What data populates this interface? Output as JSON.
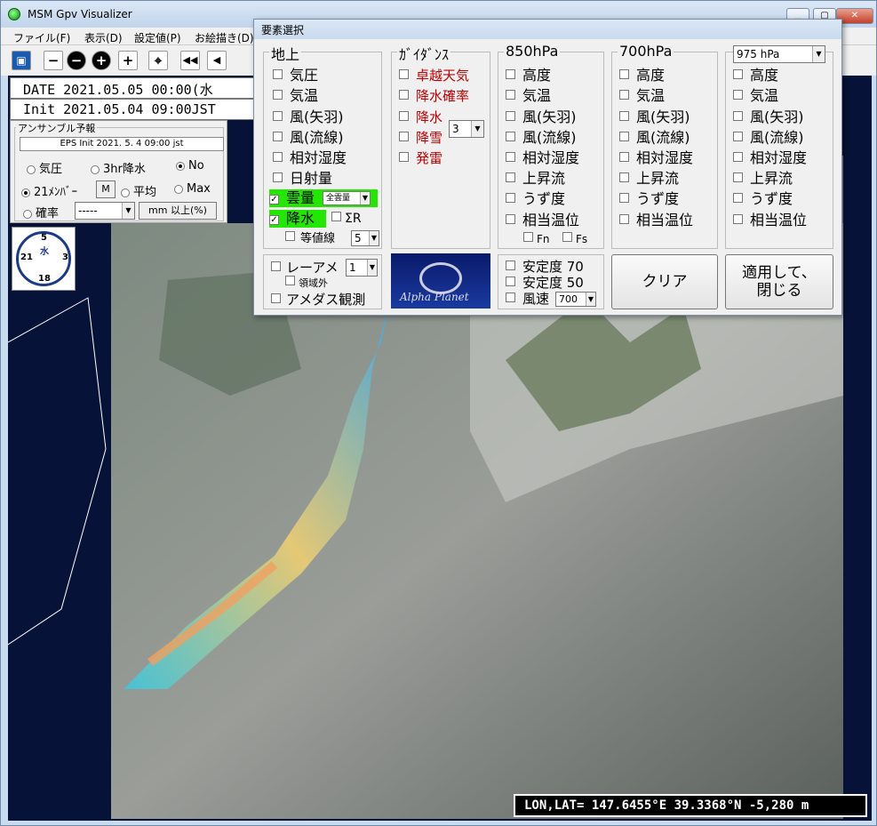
{
  "window": {
    "title": "MSM Gpv Visualizer"
  },
  "menu": [
    "ファイル(F)",
    "表示(D)",
    "設定値(P)",
    "お絵描き(D)"
  ],
  "toolbar": [
    "−",
    "+",
    "⌖",
    "◀◀",
    "◀"
  ],
  "date_line": "DATE 2021.05.05 00:00(水",
  "init_line": "Init 2021.05.04 09:00JST",
  "ensemble": {
    "title": "アンサンブル予報",
    "info": "EPS Init   2021. 5. 4   09:00 jst",
    "row1": [
      "気圧",
      "3hr降水",
      "No"
    ],
    "row1_selected": "No",
    "row2": [
      "21ﾒﾝﾊﾞｰ",
      "平均",
      "Max"
    ],
    "row2_selected": "21ﾒﾝﾊﾞｰ",
    "m_button": "M",
    "prob_label": "確率",
    "prob_value": "-----",
    "prob_unit_button": "mm 以上(%)"
  },
  "clock": {
    "top": "5",
    "center": "水",
    "left": "21",
    "right": "3",
    "bottom": "18"
  },
  "coord_readout": "LON,LAT= 147.6455°E  39.3368°N  -5,280 m",
  "dialog": {
    "title": "要素選択",
    "surface": {
      "label": "地上",
      "items": [
        "気圧",
        "気温",
        "風(矢羽)",
        "風(流線)",
        "相対湿度",
        "日射量"
      ],
      "cloud": "雲量",
      "cloud_combo": "全雲量",
      "precip": "降水",
      "sigma": "ΣR",
      "contour": "等値線",
      "contour_combo": "5"
    },
    "guidance": {
      "label": "ｶﾞｲﾀﾞﾝｽ",
      "items": [
        "卓越天気",
        "降水確率",
        "降水",
        "降雪",
        "発雷"
      ],
      "combo": "3"
    },
    "p850": {
      "label": "850hPa",
      "items": [
        "高度",
        "気温",
        "風(矢羽)",
        "風(流線)",
        "相対湿度",
        "上昇流",
        "うず度",
        "相当温位"
      ],
      "fn": "Fn",
      "fs": "Fs"
    },
    "p700": {
      "label": "700hPa",
      "items": [
        "高度",
        "気温",
        "風(矢羽)",
        "風(流線)",
        "相対湿度",
        "上昇流",
        "うず度",
        "相当温位"
      ]
    },
    "p975": {
      "combo": "975 hPa",
      "items": [
        "高度",
        "気温",
        "風(矢羽)",
        "風(流線)",
        "相対湿度",
        "上昇流",
        "うず度",
        "相当温位"
      ]
    },
    "radar": {
      "label": "レーアメ",
      "combo": "1",
      "outside": "領域外",
      "amedas": "アメダス観測"
    },
    "logo_text": "Alpha Planet",
    "stability": {
      "s70": "安定度 70",
      "s50": "安定度 50",
      "wind": "風速",
      "wind_combo": "700"
    },
    "clear_button": "クリア",
    "apply_button_line1": "適用して、",
    "apply_button_line2": "閉じる"
  },
  "colors": {
    "highlight": "#22e800",
    "map_sea": "#071238",
    "guidance_text": "#c00000"
  }
}
